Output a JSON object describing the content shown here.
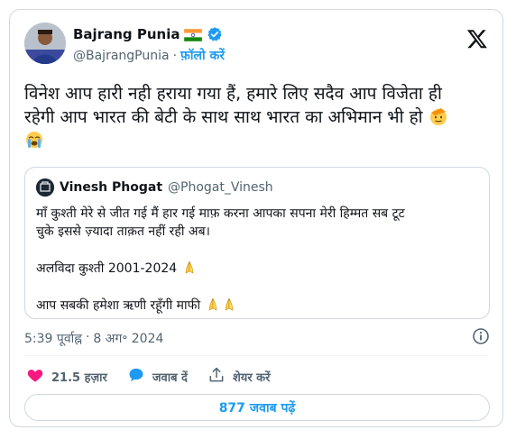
{
  "author": {
    "display_name": "Bajrang Punia",
    "handle": "@BajrangPunia",
    "separator": "·",
    "follow_label": "फ़ॉलो करें",
    "flag_icon": "india-flag-icon",
    "verified_icon": "verified-badge-icon",
    "verified_color": "#1d9bf0"
  },
  "tweet": {
    "line1": "विनेश आप हारी नही हराया गया हैं, हमारे लिए सदैव आप विजेता ही",
    "line2": "रहेगी आप भारत की बेटी के साथ साथ भारत का अभिमान भी हो",
    "emoji_1": "saluting-face-emoji",
    "emoji_2": "loudly-crying-face-emoji"
  },
  "quoted": {
    "display_name": "Vinesh Phogat",
    "handle": "@Phogat_Vinesh",
    "text_line1": "माँ कुश्ती मेरे से जीत गई मैं हार गई माफ़ करना आपका सपना मेरी हिम्मत सब टूट",
    "text_line2": "चुके इससे ज़्यादा ताक़त नहीं रही अब।",
    "text_line3": "अलविदा कुश्ती 2001-2024",
    "text_line4": "आप सबकी हमेशा ऋणी रहूँगी माफी",
    "hands_icon": "folded-hands-emoji"
  },
  "meta": {
    "time": "5:39 पूर्वाह्न",
    "separator": "·",
    "date": "8 अग॰ 2024"
  },
  "actions": {
    "like_count": "21.5 हज़ार",
    "reply_label": "जवाब दें",
    "share_label": "शेयर करें",
    "like_color": "#f91880",
    "reply_color": "#1d9bf0"
  },
  "replies_button": "877 जवाब पढ़ें",
  "brand": {
    "logo": "x-logo-icon",
    "accent": "#1d9bf0"
  }
}
